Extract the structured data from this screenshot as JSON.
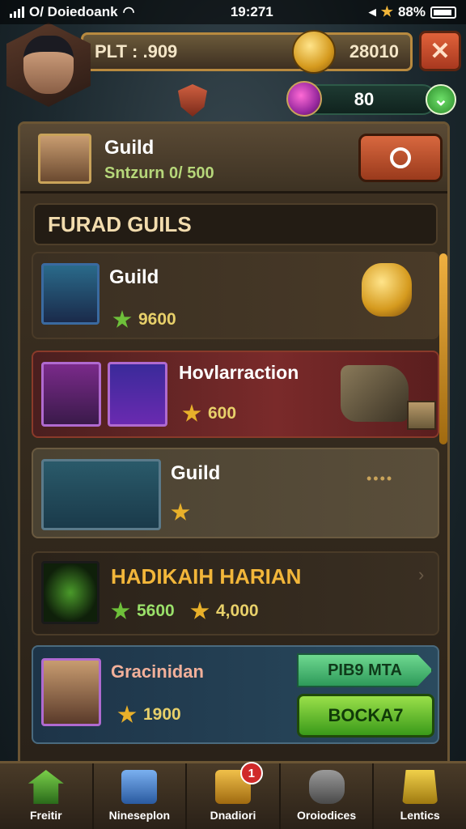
{
  "status_bar": {
    "carrier": "O/ Doiedoank",
    "time": "19:271",
    "battery": "88%"
  },
  "top_bar": {
    "currency_label": "PLT : .909",
    "gold_value": "28010",
    "close_label": "✕"
  },
  "gem_bar": {
    "value": "80",
    "plus_label": "⌄"
  },
  "guild_header": {
    "title": "Guild",
    "subtitle": "Sntzurn 0/ 500"
  },
  "section": {
    "title": "FURAD GUILS"
  },
  "cards": [
    {
      "title": "Guild",
      "stat": "9600"
    },
    {
      "title": "Hovlarraction",
      "stat": "600"
    },
    {
      "title": "Guild",
      "stat": "",
      "extra": "••••"
    },
    {
      "title": "HADIKAIH HARIAN",
      "stat1": "5600",
      "stat2": "4,000",
      "chevron": "›"
    },
    {
      "title": "Gracinidan",
      "stat": "1900",
      "pill_label": "PIB9 MTA",
      "button_label": "BOCKA7"
    }
  ],
  "bottom_nav": [
    {
      "label": "Freitir",
      "badge": ""
    },
    {
      "label": "Nineseplon",
      "badge": ""
    },
    {
      "label": "Dnadiori",
      "badge": "1"
    },
    {
      "label": "Oroiodices",
      "badge": ""
    },
    {
      "label": "Lentics",
      "badge": ""
    }
  ],
  "colors": {
    "accent_gold": "#c9a35a",
    "panel_bg": "#3e3222",
    "highlight_red": "#7a2a2a",
    "button_green": "#3a9a1a"
  }
}
